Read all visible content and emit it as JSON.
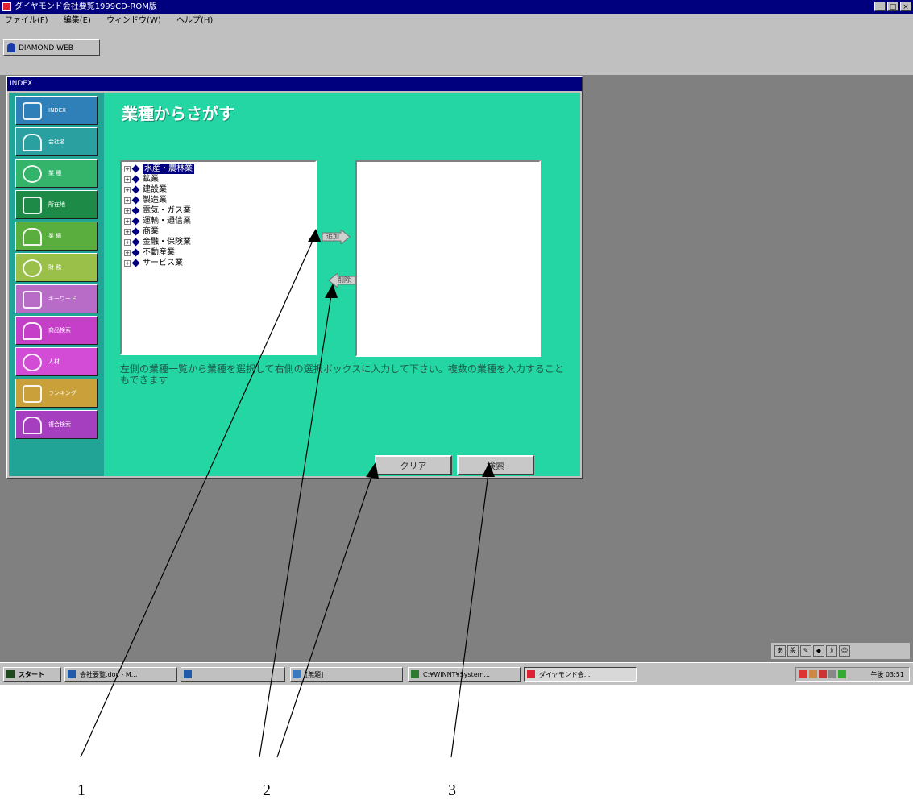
{
  "window": {
    "title": "ダイヤモンド会社要覧1999CD-ROM版",
    "controls": [
      "_",
      "□",
      "×"
    ]
  },
  "menu": [
    "ファイル(F)",
    "編集(E)",
    "ウィンドウ(W)",
    "ヘルプ(H)"
  ],
  "toolbar": {
    "button_label": "DIAMOND WEB"
  },
  "index_window": {
    "title": "INDEX"
  },
  "sidebar": {
    "items": [
      {
        "label": "INDEX",
        "color": "#2f7fb8"
      },
      {
        "label": "会社名",
        "color": "#2aa0a0"
      },
      {
        "label": "業 種",
        "color": "#34b46a"
      },
      {
        "label": "所在地",
        "color": "#1d8a48"
      },
      {
        "label": "業 績",
        "color": "#5aae3e"
      },
      {
        "label": "財 務",
        "color": "#9ac04a"
      },
      {
        "label": "キーワード",
        "color": "#b86cc8"
      },
      {
        "label": "商品検索",
        "color": "#c63fc9"
      },
      {
        "label": "人材",
        "color": "#d34cd6"
      },
      {
        "label": "ランキング",
        "color": "#c9a03a"
      },
      {
        "label": "複合検索",
        "color": "#a63ec0"
      }
    ]
  },
  "main": {
    "heading": "業種からさがす",
    "industries": [
      {
        "label": "水産・農林業",
        "selected": true
      },
      {
        "label": "鉱業",
        "selected": false
      },
      {
        "label": "建設業",
        "selected": false
      },
      {
        "label": "製造業",
        "selected": false
      },
      {
        "label": "電気・ガス業",
        "selected": false
      },
      {
        "label": "運輸・通信業",
        "selected": false
      },
      {
        "label": "商業",
        "selected": false
      },
      {
        "label": "金融・保険業",
        "selected": false
      },
      {
        "label": "不動産業",
        "selected": false
      },
      {
        "label": "サービス業",
        "selected": false
      }
    ],
    "add_button_label": "追加",
    "remove_button_label": "削除",
    "instructions": "左側の業種一覧から業種を選択して右側の選択ボックスに入力して下さい。複数の業種を入力することもできます",
    "clear_button_label": "クリア",
    "search_button_label": "検索"
  },
  "tray_icons": [
    "あ",
    "般",
    "✎",
    "◆",
    "ｶ",
    "☺"
  ],
  "taskbar": {
    "start_label": "スタート",
    "tasks": [
      {
        "label": "会社要覧.doc - M..."
      },
      {
        "label": ""
      },
      {
        "label": "[無題]"
      },
      {
        "label": "C:¥WINNT¥System..."
      },
      {
        "label": "ダイヤモンド会..."
      }
    ],
    "clock": "午後 03:51"
  },
  "callouts": [
    "1",
    "2",
    "3"
  ]
}
